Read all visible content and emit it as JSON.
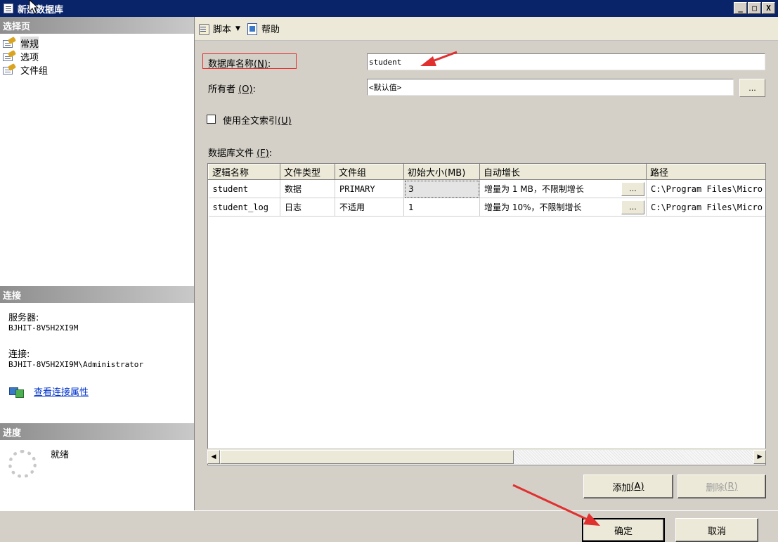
{
  "window": {
    "title": "新建数据库"
  },
  "titlebar_buttons": [
    "_",
    "□",
    "X"
  ],
  "left": {
    "select_page_header": "选择页",
    "pages": [
      {
        "label": "常规",
        "icon": "page-settings-icon",
        "selected": true
      },
      {
        "label": "选项",
        "icon": "page-settings-icon",
        "selected": false
      },
      {
        "label": "文件组",
        "icon": "page-settings-icon",
        "selected": false
      }
    ],
    "connection_header": "连接",
    "server_label": "服务器:",
    "server_value": "BJHIT-8V5H2XI9M",
    "connection_label": "连接:",
    "connection_value": "BJHIT-8V5H2XI9M\\Administrator",
    "view_connection_link": "查看连接属性",
    "progress_header": "进度",
    "progress_status": "就绪"
  },
  "toolbar": {
    "script_label": "脚本",
    "help_label": "帮助"
  },
  "form": {
    "db_name_label": "数据库名称",
    "db_name_accel": "(N)",
    "db_name_value": "student",
    "owner_label": "所有者",
    "owner_accel": "(O)",
    "owner_value": "<默认值>",
    "owner_browse": "...",
    "fulltext_label": "使用全文索引",
    "fulltext_accel": "(U)",
    "fulltext_checked": false,
    "db_files_label": "数据库文件",
    "db_files_accel": "(F)"
  },
  "grid": {
    "columns": [
      "逻辑名称",
      "文件类型",
      "文件组",
      "初始大小(MB)",
      "自动增长",
      "路径"
    ],
    "rows": [
      {
        "logical_name": "student",
        "file_type": "数据",
        "filegroup": "PRIMARY",
        "initial_size": "3",
        "autogrowth": "增量为 1 MB，不限制增长",
        "browse": "...",
        "path": "C:\\Program Files\\Micro"
      },
      {
        "logical_name": "student_log",
        "file_type": "日志",
        "filegroup": "不适用",
        "initial_size": "1",
        "autogrowth": "增量为 10%，不限制增长",
        "browse": "...",
        "path": "C:\\Program Files\\Micro"
      }
    ]
  },
  "buttons": {
    "add_label": "添加",
    "add_accel": "(A)",
    "remove_label": "删除",
    "remove_accel": "(R)",
    "ok_label": "确定",
    "cancel_label": "取消"
  },
  "colors": {
    "titlebar": "#0a246a",
    "annotation": "#e03030",
    "link": "#0033cc"
  }
}
